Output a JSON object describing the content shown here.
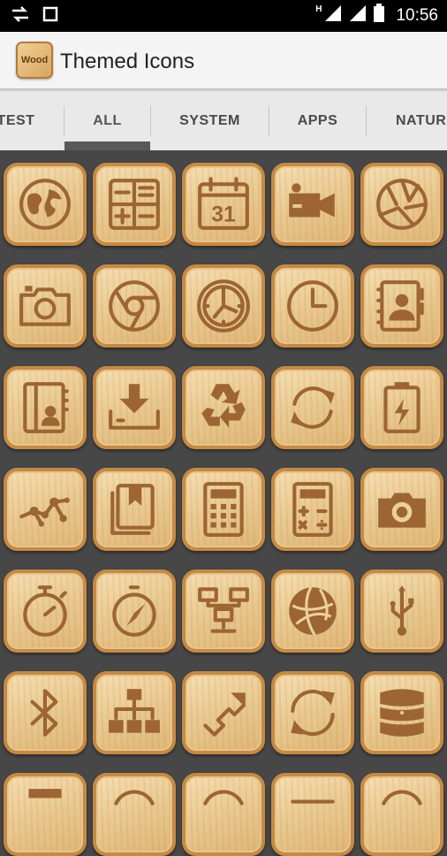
{
  "status_bar": {
    "time": "10:56",
    "network_label": "H"
  },
  "app_bar": {
    "logo_text": "Wood",
    "title": "Themed Icons"
  },
  "tabs": [
    {
      "label": "TEST"
    },
    {
      "label": "ALL",
      "selected": true
    },
    {
      "label": "SYSTEM"
    },
    {
      "label": "APPS"
    },
    {
      "label": "NATURE"
    }
  ],
  "icons": [
    [
      "globe-icon",
      "calculator-grid-icon",
      "calendar-icon",
      "video-camera-icon",
      "aperture-icon"
    ],
    [
      "camera-icon",
      "chrome-icon",
      "wall-clock-icon",
      "clock-icon",
      "contacts-book-icon"
    ],
    [
      "address-book-icon",
      "download-tray-icon",
      "recycle-icon",
      "sync-icon",
      "battery-charging-icon"
    ],
    [
      "network-nodes-icon",
      "book-bookmark-icon",
      "calculator-keypad-icon",
      "calculator-icon",
      "camera-icon"
    ],
    [
      "stopwatch-icon",
      "compass-icon",
      "lan-network-icon",
      "globe-network-icon",
      "usb-icon"
    ],
    [
      "bluetooth-icon",
      "hierarchy-icon",
      "share-route-icon",
      "refresh-icon",
      "database-icon"
    ],
    [
      "partial-icon",
      "partial-icon",
      "partial-icon",
      "partial-icon",
      "partial-icon"
    ]
  ],
  "colors": {
    "tile_wood": "#eacb93",
    "tile_border": "#c58a45",
    "icon_engrave": "#9c6533",
    "background": "#474747"
  }
}
